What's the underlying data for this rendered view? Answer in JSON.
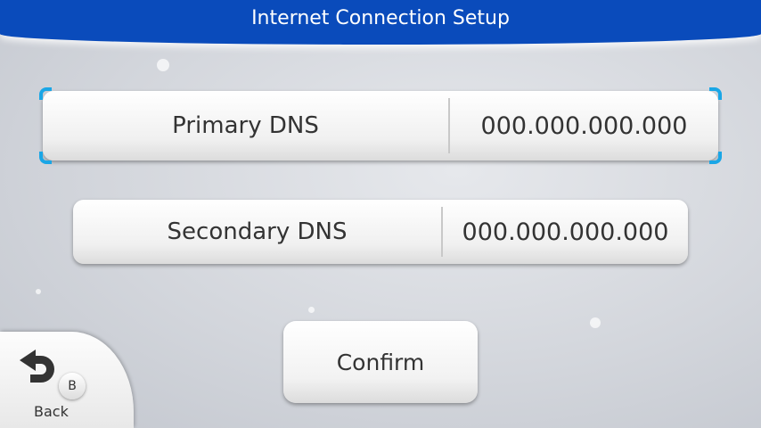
{
  "header": {
    "title": "Internet Connection Setup"
  },
  "fields": [
    {
      "label": "Primary DNS",
      "value": "000.000.000.000",
      "selected": true
    },
    {
      "label": "Secondary DNS",
      "value": "000.000.000.000",
      "selected": false
    }
  ],
  "confirm_label": "Confirm",
  "back": {
    "label": "Back",
    "button_hint": "B",
    "icon": "back-arrow-icon"
  },
  "colors": {
    "header": "#0a4bbb",
    "selection": "#1aa6e6"
  }
}
